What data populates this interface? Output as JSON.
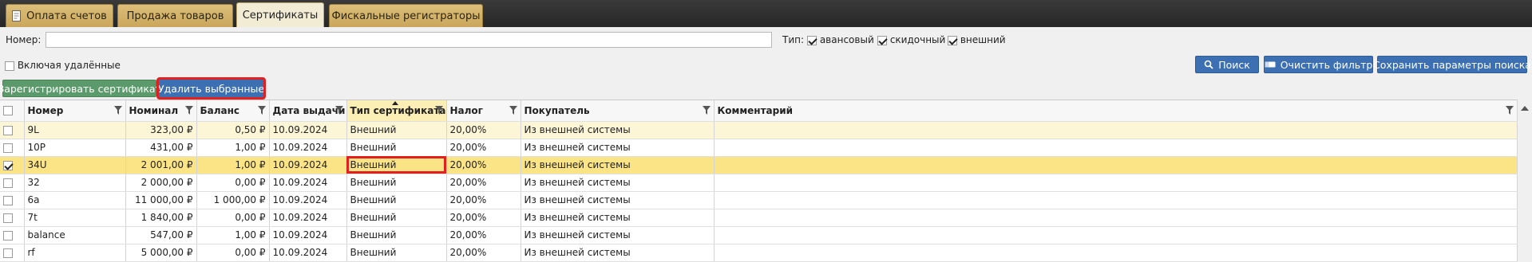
{
  "tabs": [
    {
      "label": "Оплата счетов",
      "active": false
    },
    {
      "label": "Продажа товаров",
      "active": false
    },
    {
      "label": "Сертификаты",
      "active": true
    },
    {
      "label": "Фискальные регистраторы",
      "active": false
    }
  ],
  "filters": {
    "number_label": "Номер:",
    "number_value": "",
    "type_label": "Тип:",
    "types": [
      {
        "label": "авансовый",
        "checked": true
      },
      {
        "label": "скидочный",
        "checked": true
      },
      {
        "label": "внешний",
        "checked": true
      }
    ],
    "include_deleted_label": "Включая удалённые",
    "include_deleted_checked": false
  },
  "buttons": {
    "search": "Поиск",
    "clear_filter": "Очистить фильтр",
    "save_params": "Сохранить параметры поиска",
    "register": "Зарегистрировать сертификат",
    "delete_selected": "Удалить выбранные"
  },
  "table": {
    "columns": [
      "Номер",
      "Номинал",
      "Баланс",
      "Дата выдачи",
      "Тип сертификата",
      "Налог",
      "Покупатель",
      "Комментарий"
    ],
    "rows": [
      {
        "checked": false,
        "number": "9L",
        "nominal": "323,00 ₽",
        "balance": "0,50 ₽",
        "date": "10.09.2024",
        "type": "Внешний",
        "tax": "20,00%",
        "buyer": "Из внешней системы",
        "comment": ""
      },
      {
        "checked": false,
        "number": "10P",
        "nominal": "431,00 ₽",
        "balance": "1,00 ₽",
        "date": "10.09.2024",
        "type": "Внешний",
        "tax": "20,00%",
        "buyer": "Из внешней системы",
        "comment": ""
      },
      {
        "checked": true,
        "number": "34U",
        "nominal": "2 001,00 ₽",
        "balance": "1,00 ₽",
        "date": "10.09.2024",
        "type": "Внешний",
        "tax": "20,00%",
        "buyer": "Из внешней системы",
        "comment": ""
      },
      {
        "checked": false,
        "number": "32",
        "nominal": "2 000,00 ₽",
        "balance": "0,00 ₽",
        "date": "10.09.2024",
        "type": "Внешний",
        "tax": "20,00%",
        "buyer": "Из внешней системы",
        "comment": ""
      },
      {
        "checked": false,
        "number": "6a",
        "nominal": "11 000,00 ₽",
        "balance": "1 000,00 ₽",
        "date": "10.09.2024",
        "type": "Внешний",
        "tax": "20,00%",
        "buyer": "Из внешней системы",
        "comment": ""
      },
      {
        "checked": false,
        "number": "7t",
        "nominal": "1 840,00 ₽",
        "balance": "0,00 ₽",
        "date": "10.09.2024",
        "type": "Внешний",
        "tax": "20,00%",
        "buyer": "Из внешней системы",
        "comment": ""
      },
      {
        "checked": false,
        "number": "balance",
        "nominal": "547,00 ₽",
        "balance": "1,00 ₽",
        "date": "10.09.2024",
        "type": "Внешний",
        "tax": "20,00%",
        "buyer": "Из внешней системы",
        "comment": ""
      },
      {
        "checked": false,
        "number": "rf",
        "nominal": "5 000,00 ₽",
        "balance": "0,00 ₽",
        "date": "10.09.2024",
        "type": "Внешний",
        "tax": "20,00%",
        "buyer": "Из внешней системы",
        "comment": ""
      }
    ]
  },
  "icons": {
    "document": "document-icon",
    "search": "magnifier-icon",
    "clear": "eraser-icon",
    "filter": "funnel-icon"
  },
  "colors": {
    "tab_gold": "#c9a65a",
    "button_blue": "#3d6fb3",
    "button_green": "#5b9a6a",
    "selected_row": "#fbe486",
    "highlight_red": "#e1201f"
  }
}
